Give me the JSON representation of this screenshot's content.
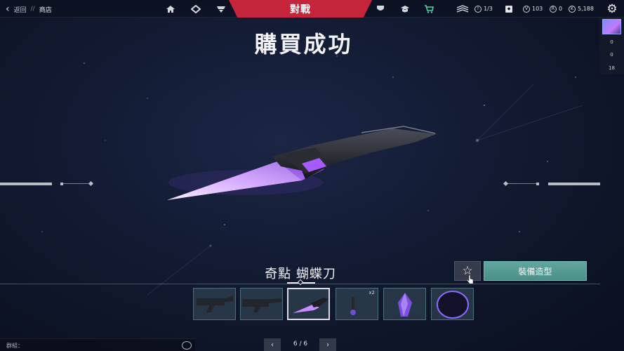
{
  "topbar": {
    "back_label": "返回",
    "breadcrumb_sep": "//",
    "current_page": "商店",
    "versus_label": "對戰",
    "stats": {
      "mission": "1/3",
      "vp": "103",
      "radianite": "0",
      "kingdom": "5,188"
    }
  },
  "side_panel": {
    "values": [
      "0",
      "0",
      "18"
    ]
  },
  "main": {
    "title": "購買成功",
    "item_name": "奇點 蝴蝶刀",
    "equip_label": "裝備造型",
    "variant_badge": "x2"
  },
  "bottom": {
    "chat_label": "群組：",
    "pager": "6 / 6"
  },
  "colors": {
    "accent_red": "#c5253a",
    "equip_teal": "#5aa199",
    "blade_violet": "#b46bff"
  },
  "icons": {
    "back": "chevron-left-icon",
    "home": "home-icon",
    "favorite": "star-icon",
    "settings": "gear-icon"
  }
}
